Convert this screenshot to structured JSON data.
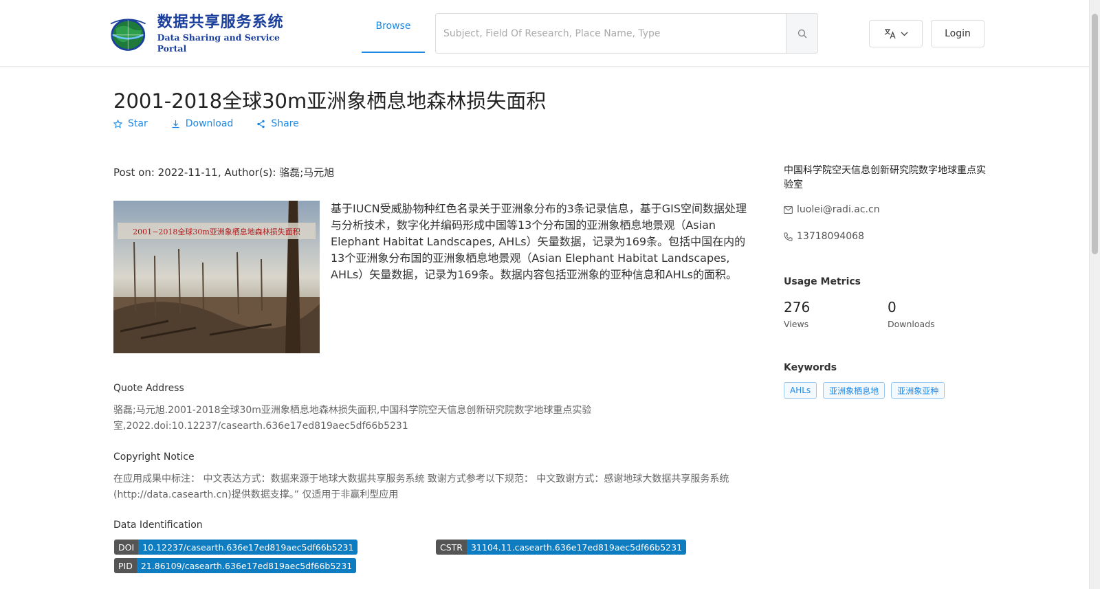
{
  "header": {
    "logo_cn": "数据共享服务系统",
    "logo_en": "Data Sharing and Service Portal",
    "nav_browse": "Browse",
    "search_placeholder": "Subject, Field Of Research, Place Name, Type",
    "login_label": "Login"
  },
  "dataset": {
    "title": "2001-2018全球30m亚洲象栖息地森林损失面积",
    "actions": {
      "star": "Star",
      "download": "Download",
      "share": "Share"
    },
    "post_info": "Post on: 2022-11-11, Author(s): 骆磊;马元旭",
    "cover_caption": "2001−2018全球30m亚洲象栖息地森林损失面积",
    "description": "基于IUCN受威胁物种红色名录关于亚洲象分布的3条记录信息，基于GIS空间数据处理与分析技术，数字化并编码形成中国等13个分布国的亚洲象栖息地景观（Asian Elephant Habitat Landscapes, AHLs）矢量数据，记录为169条。包括中国在内的13个亚洲象分布国的亚洲象栖息地景观（Asian Elephant Habitat Landscapes, AHLs）矢量数据，记录为169条。数据内容包括亚洲象的亚种信息和AHLs的面积。",
    "quote_heading": "Quote Address",
    "quote_text": "骆磊;马元旭.2001-2018全球30m亚洲象栖息地森林损失面积,中国科学院空天信息创新研究院数字地球重点实验室,2022.doi:10.12237/casearth.636e17ed819aec5df66b5231",
    "copyright_heading": "Copyright Notice",
    "copyright_text": "在应用成果中标注： 中文表达方式：数据来源于地球大数据共享服务系统 致谢方式参考以下规范： 中文致谢方式：感谢地球大数据共享服务系统(http://data.casearth.cn)提供数据支撑。” 仅适用于非赢利型应用",
    "id_heading": "Data Identification",
    "identifiers": {
      "doi_key": "DOI",
      "doi_val": "10.12237/casearth.636e17ed819aec5df66b5231",
      "cstr_key": "CSTR",
      "cstr_val": "31104.11.casearth.636e17ed819aec5df66b5231",
      "pid_key": "PID",
      "pid_val": "21.86109/casearth.636e17ed819aec5df66b5231"
    }
  },
  "sidebar": {
    "org": "中国科学院空天信息创新研究院数字地球重点实验室",
    "email": "luolei@radi.ac.cn",
    "phone": "13718094068",
    "metrics_heading": "Usage Metrics",
    "views": "276",
    "views_label": "Views",
    "downloads": "0",
    "downloads_label": "Downloads",
    "keywords_heading": "Keywords",
    "keywords": [
      "AHLs",
      "亚洲象栖息地",
      "亚洲象亚种"
    ]
  },
  "colors": {
    "accent": "#1e88e5",
    "logo_blue": "#1a3f9c",
    "pill_key": "#555555",
    "pill_value": "#0d7cc1"
  }
}
